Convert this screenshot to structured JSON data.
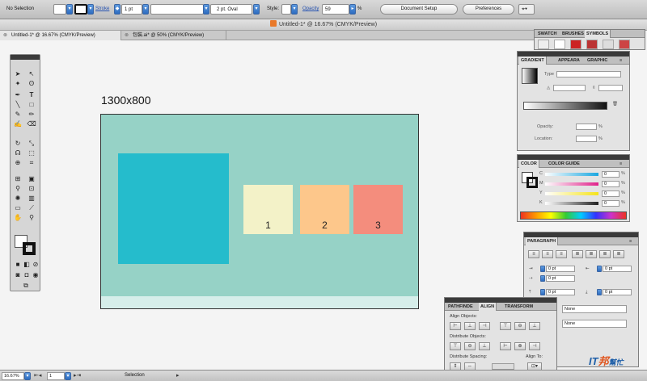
{
  "control_bar": {
    "selection": "No Selection",
    "stroke_label": "Stroke",
    "stroke_weight": "1 pt",
    "brush": "2 pt. Oval",
    "style_label": "Style:",
    "opacity_label": "Opacity",
    "opacity_value": "59",
    "opacity_unit": "%",
    "document_setup": "Document Setup",
    "preferences": "Preferences"
  },
  "window": {
    "title": "Untitled-1* @ 16.67% (CMYK/Preview)"
  },
  "doc_tabs": [
    {
      "label": "Untitled-1* @ 16.67% (CMYK/Preview)"
    },
    {
      "label": "包裝.ai* @ 50% (CMYK/Preview)"
    }
  ],
  "artboard": {
    "label": "1300x800",
    "squares": [
      {
        "label": "1",
        "color": "#f3f2c8"
      },
      {
        "label": "2",
        "color": "#fdc78b"
      },
      {
        "label": "3",
        "color": "#f48d7d"
      }
    ],
    "big_square_color": "#25bccc",
    "background_color": "#96d2c6"
  },
  "swatches_panel": {
    "tabs": [
      "SWATCH",
      "BRUSHES",
      "SYMBOLS"
    ]
  },
  "gradient_panel": {
    "tabs": [
      "GRADIENT",
      "APPEARA",
      "GRAPHIC"
    ],
    "type_label": "Type",
    "opacity_label": "Opacity:",
    "location_label": "Location:",
    "unit": "%"
  },
  "color_panel": {
    "tabs": [
      "COLOR",
      "COLOR GUIDE"
    ],
    "channels": [
      {
        "name": "C",
        "value": "0",
        "color": "#1aa7e0"
      },
      {
        "name": "M",
        "value": "0",
        "color": "#e0218a"
      },
      {
        "name": "Y",
        "value": "0",
        "color": "#f5e31a"
      },
      {
        "name": "K",
        "value": "0",
        "color": "#222222"
      }
    ],
    "unit": "%"
  },
  "paragraph_panel": {
    "tabs": [
      "PARAGRAPH"
    ],
    "indent_values": [
      "0 pt",
      "0 pt",
      "0 pt",
      "0 pt",
      "0 pt"
    ],
    "hyphen_options": [
      "None",
      "None"
    ]
  },
  "align_panel": {
    "tabs": [
      "PATHFINDE",
      "ALIGN",
      "TRANSFORM"
    ],
    "align_objects": "Align Objects:",
    "distribute_objects": "Distribute Objects:",
    "distribute_spacing": "Distribute Spacing:",
    "align_to": "Align To:"
  },
  "status_bar": {
    "zoom": "16.67%",
    "page": "1",
    "tool": "Selection"
  },
  "watermark": {
    "text": "IT",
    "highlight": "邦",
    "suffix": "幫忙"
  }
}
